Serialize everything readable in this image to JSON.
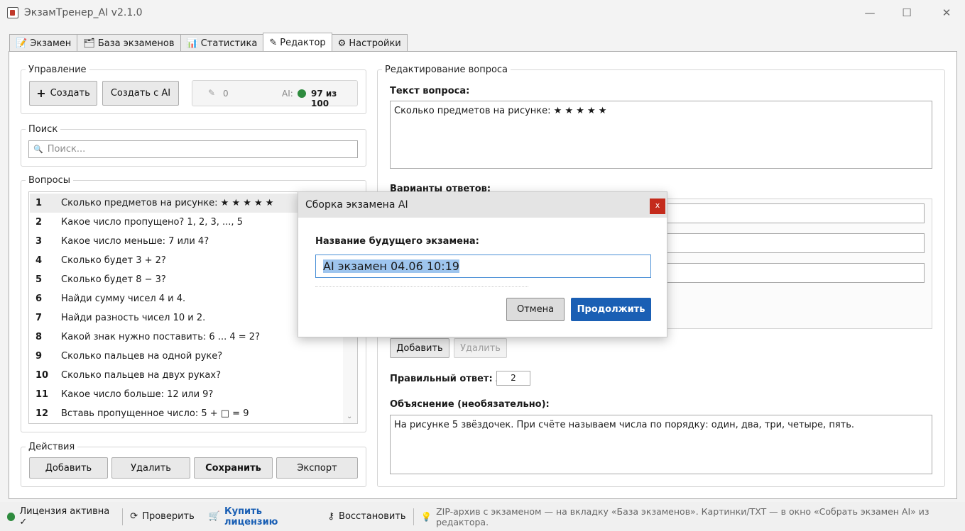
{
  "window": {
    "title": "ЭкзамТренер_AI v2.1.0",
    "minimize": "—",
    "maximize": "☐",
    "close": "✕"
  },
  "tabs": [
    {
      "label": "Экзамен",
      "icon": "📝"
    },
    {
      "label": "База экзаменов",
      "icon": "🗂"
    },
    {
      "label": "Статистика",
      "icon": "📊"
    },
    {
      "label": "Редактор",
      "icon": "✎"
    },
    {
      "label": "Настройки",
      "icon": "⚙"
    }
  ],
  "management": {
    "legend": "Управление",
    "create_label": "Создать",
    "create_plus": "+",
    "create_ai_label": "Создать с AI",
    "edits_count": "0",
    "ai_label": "AI:",
    "ai_quota": "97 из 100",
    "ai_status_color": "#2e8b3e"
  },
  "search": {
    "legend": "Поиск",
    "placeholder": "Поиск...",
    "icon": "🔍"
  },
  "questions": {
    "legend": "Вопросы",
    "items": [
      {
        "num": "1",
        "text": "Сколько предметов на рисунке: ★ ★ ★ ★ ★"
      },
      {
        "num": "2",
        "text": "Какое число пропущено? 1, 2, 3, ..., 5"
      },
      {
        "num": "3",
        "text": "Какое число меньше: 7 или 4?"
      },
      {
        "num": "4",
        "text": "Сколько будет 3 + 2?"
      },
      {
        "num": "5",
        "text": "Сколько будет 8 − 3?"
      },
      {
        "num": "6",
        "text": "Найди сумму чисел 4 и 4."
      },
      {
        "num": "7",
        "text": "Найди разность чисел 10 и 2."
      },
      {
        "num": "8",
        "text": "Какой знак нужно поставить: 6 ... 4 = 2?"
      },
      {
        "num": "9",
        "text": "Сколько пальцев на одной руке?"
      },
      {
        "num": "10",
        "text": "Сколько пальцев на двух руках?"
      },
      {
        "num": "11",
        "text": "Какое число больше: 12 или 9?"
      },
      {
        "num": "12",
        "text": "Вставь пропущенное число: 5 + □ = 9"
      }
    ]
  },
  "actions": {
    "legend": "Действия",
    "add": "Добавить",
    "delete": "Удалить",
    "save": "Сохранить",
    "export": "Экспорт"
  },
  "editor": {
    "legend": "Редактирование вопроса",
    "question_label": "Текст вопроса:",
    "question_text": "Сколько предметов на рисунке: ★ ★ ★ ★ ★",
    "answers_label": "Варианты ответов:",
    "add_answer": "Добавить",
    "delete_answer": "Удалить",
    "correct_label": "Правильный ответ: №",
    "correct_value": "2",
    "explanation_label": "Объяснение (необязательно):",
    "explanation_text": "На рисунке 5 звёздочек. При счёте называем числа по порядку: один, два, три, четыре, пять."
  },
  "dialog": {
    "title": "Сборка экзамена AI",
    "close": "x",
    "name_label": "Название будущего экзамена:",
    "name_value": "AI экзамен 04.06 10:19",
    "cancel": "Отмена",
    "continue": "Продолжить",
    "primary_color": "#1a5fb4"
  },
  "statusbar": {
    "license": "Лицензия активна ✓",
    "check": "Проверить",
    "buy": "Купить лицензию",
    "restore": "Восстановить",
    "hint": "ZIP-архив с экзаменом — на вкладку «База экзаменов». Картинки/TXT — в окно «Собрать экзамен AI» из редактора."
  }
}
